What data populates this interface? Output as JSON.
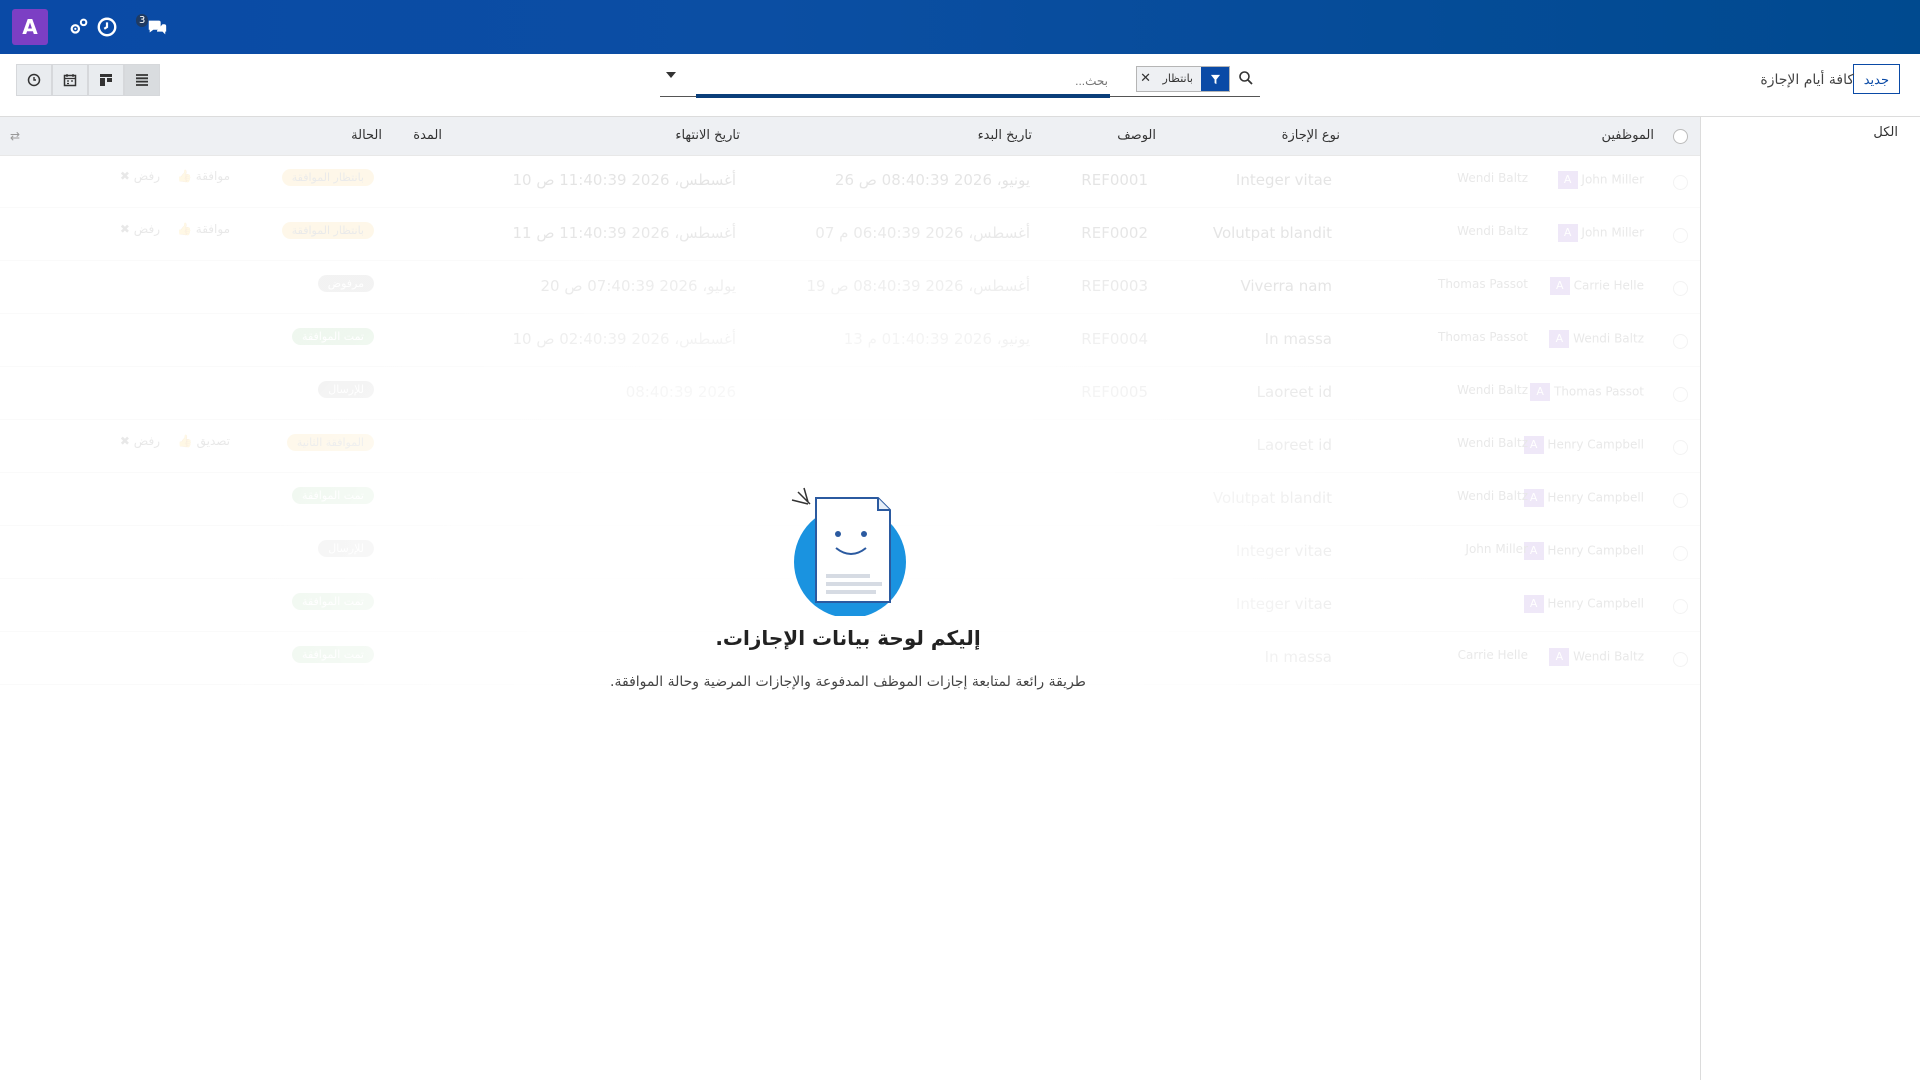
{
  "navbar": {
    "avatar_letter": "A",
    "messages_count": "3",
    "icons": [
      "settings-icon",
      "clock-icon",
      "chat-icon"
    ]
  },
  "control_panel": {
    "new_button": "جديد",
    "breadcrumb": "كافة أيام الإجازة",
    "search": {
      "facet_value": "بانتظار",
      "placeholder": "بحث..."
    },
    "views": [
      "list-view",
      "kanban-view",
      "calendar-view",
      "activity-view"
    ]
  },
  "sidebar": {
    "all_label": "الكل"
  },
  "table": {
    "columns": {
      "employees": "الموظفين",
      "leave_type": "نوع الإجازة",
      "description": "الوصف",
      "start_date": "تاريخ البدء",
      "end_date": "تاريخ الانتهاء",
      "duration": "المدة",
      "status": "الحالة"
    },
    "rows": [
      {
        "emp1": "John Miller",
        "emp2": "Wendi Baltz",
        "type": "Integer vitae",
        "desc": "REF0001",
        "start": "26 يونيو، 2026 08:40:39 ص",
        "end": "10 أغسطس، 2026 11:40:39 ص",
        "status": "بانتظار الموافقة",
        "action1": "موافقة",
        "action2": "رفض"
      },
      {
        "emp1": "John Miller",
        "emp2": "Wendi Baltz",
        "type": "Volutpat blandit",
        "desc": "REF0002",
        "start": "07 أغسطس، 2026 06:40:39 م",
        "end": "11 أغسطس، 2026 11:40:39 ص",
        "status": "بانتظار الموافقة",
        "action1": "موافقة",
        "action2": "رفض"
      },
      {
        "emp1": "Carrie Helle",
        "emp2": "Thomas Passot",
        "type": "Viverra nam",
        "desc": "REF0003",
        "start": "19 أغسطس، 2026 08:40:39 ص",
        "end": "20 يوليو، 2026 07:40:39 ص",
        "status": "مرفوض",
        "action1": "",
        "action2": ""
      },
      {
        "emp1": "Wendi Baltz",
        "emp2": "Thomas Passot",
        "type": "In massa",
        "desc": "REF0004",
        "start": "13 يونيو، 2026 01:40:39 م",
        "end": "10 أغسطس، 2026 02:40:39 ص",
        "status": "تمت الموافقة",
        "action1": "",
        "action2": ""
      },
      {
        "emp1": "Thomas Passot",
        "emp2": "Wendi Baltz",
        "type": "Laoreet id",
        "desc": "REF0005",
        "start": "",
        "end": "08:40:39 2026",
        "status": "للإرسال",
        "action1": "",
        "action2": ""
      },
      {
        "emp1": "Henry Campbell",
        "emp2": "Wendi Baltz",
        "type": "Laoreet id",
        "desc": "",
        "start": "",
        "end": "",
        "status": "الموافقة الثانية",
        "action1": "تصديق",
        "action2": "رفض"
      },
      {
        "emp1": "Henry Campbell",
        "emp2": "Wendi Baltz",
        "type": "Volutpat blandit",
        "desc": "",
        "start": "",
        "end": "",
        "status": "تمت الموافقة",
        "action1": "",
        "action2": ""
      },
      {
        "emp1": "Henry Campbell",
        "emp2": "John Miller",
        "type": "Integer vitae",
        "desc": "",
        "start": "",
        "end": "",
        "status": "للإرسال",
        "action1": "",
        "action2": ""
      },
      {
        "emp1": "Henry Campbell",
        "emp2": "",
        "type": "Integer vitae",
        "desc": "",
        "start": "",
        "end": "",
        "status": "تمت الموافقة",
        "action1": "",
        "action2": ""
      },
      {
        "emp1": "Wendi Baltz",
        "emp2": "Carrie Helle",
        "type": "In massa",
        "desc": "",
        "start": "",
        "end": "",
        "status": "تمت الموافقة",
        "action1": "",
        "action2": ""
      }
    ]
  },
  "help": {
    "title": "إليكم لوحة بيانات الإجازات.",
    "text": "طريقة رائعة لمتابعة إجازات الموظف المدفوعة والإجازات المرضية وحالة الموافقة."
  }
}
